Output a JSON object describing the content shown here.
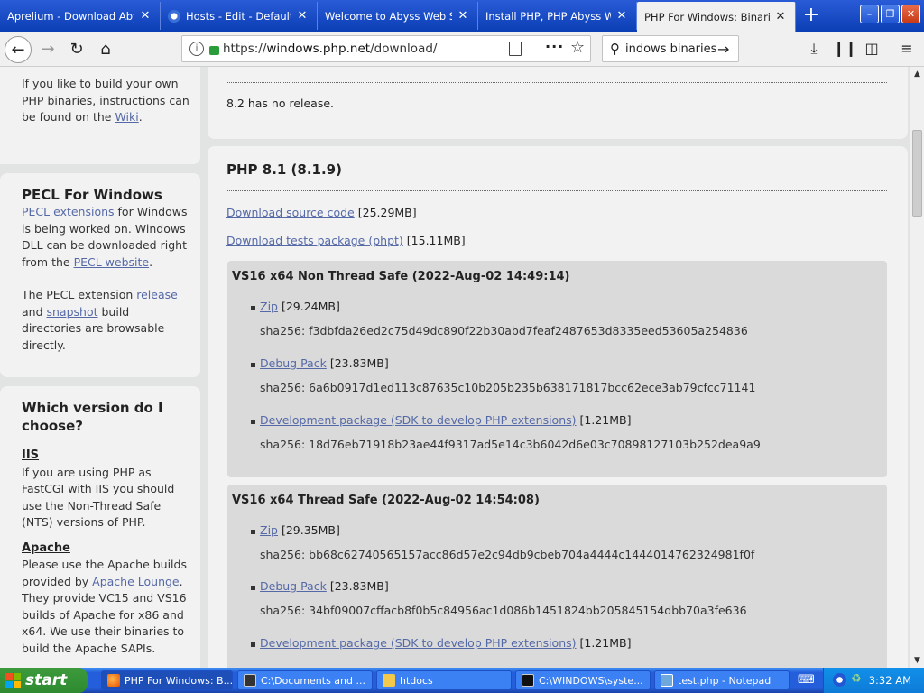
{
  "browser": {
    "tabs": [
      {
        "title": "Aprelium - Download Abyss W",
        "favicon_color": "#2257d4"
      },
      {
        "title": "Hosts - Edit - Default H",
        "favicon_color": "#3a6ed8"
      },
      {
        "title": "Welcome to Abyss Web Ser",
        "favicon_color": "#2257d4"
      },
      {
        "title": "Install PHP, PHP Abyss Web",
        "favicon_color": "#2257d4"
      },
      {
        "title": "PHP For Windows: Binaries a",
        "favicon_color": "#777bb3",
        "active": true
      }
    ],
    "url_host": "windows.php.net",
    "url_scheme": "https://",
    "url_path": "/download/",
    "search_value": "indows binaries",
    "new_tab": "+",
    "close_glyph": "✕"
  },
  "sidebar": {
    "build_own_pre": "If you like to build your own PHP binaries, instructions can be found on the ",
    "build_own_link": "Wiki",
    "build_own_post": ".",
    "pecl": {
      "title": "PECL For Windows",
      "link1": "PECL extensions",
      "text1": " for Windows is being worked on. Windows DLL can be downloaded right from the ",
      "link2": "PECL website",
      "text2": ".",
      "text3": "The PECL extension ",
      "link3": "release",
      "text4": " and ",
      "link4": "snapshot",
      "text5": " build directories are browsable directly."
    },
    "which": {
      "title": "Which version do I choose?",
      "iis_heading": "IIS",
      "iis_text": "If you are using PHP as FastCGI with IIS you should use the Non-Thread Safe (NTS) versions of PHP.",
      "apache_heading": "Apache",
      "apache_text1": "Please use the Apache builds provided by ",
      "apache_link": "Apache Lounge",
      "apache_text2": ". They provide VC15 and VS16 builds of Apache for x86 and x64. We use their binaries to build the Apache SAPIs."
    }
  },
  "main": {
    "prev_note": "8.2 has no release.",
    "release_title": "PHP 8.1 (8.1.9)",
    "source_link": "Download source code",
    "source_size": "[25.29MB]",
    "tests_link": "Download tests package (phpt)",
    "tests_size": "[15.11MB]",
    "builds": [
      {
        "title": "VS16 x64 Non Thread Safe (2022-Aug-02 14:49:14)",
        "files": [
          {
            "link": "Zip",
            "size": "[29.24MB]",
            "sha": "sha256: f3dbfda26ed2c75d49dc890f22b30abd7feaf2487653d8335eed53605a254836"
          },
          {
            "link": "Debug Pack",
            "size": "[23.83MB]",
            "sha": "sha256: 6a6b0917d1ed113c87635c10b205b235b638171817bcc62ece3ab79cfcc71141"
          },
          {
            "link": "Development package (SDK to develop PHP extensions)",
            "size": "[1.21MB]",
            "sha": "sha256: 18d76eb71918b23ae44f9317ad5e14c3b6042d6e03c70898127103b252dea9a9"
          }
        ]
      },
      {
        "title": "VS16 x64 Thread Safe (2022-Aug-02 14:54:08)",
        "files": [
          {
            "link": "Zip",
            "size": "[29.35MB]",
            "sha": "sha256: bb68c62740565157acc86d57e2c94db9cbeb704a4444c1444014762324981f0f"
          },
          {
            "link": "Debug Pack",
            "size": "[23.83MB]",
            "sha": "sha256: 34bf09007cffacb8f0b5c84956ac1d086b1451824bb205845154dbb70a3fe636"
          },
          {
            "link": "Development package (SDK to develop PHP extensions)",
            "size": "[1.21MB]",
            "sha": ""
          }
        ]
      }
    ]
  },
  "taskbar": {
    "start_label": "start",
    "tasks": [
      {
        "label": "PHP For Windows: B...",
        "icon_color": "#e87a1f",
        "active": true
      },
      {
        "label": "C:\\Documents and ...",
        "icon_color": "#333333"
      },
      {
        "label": "htdocs",
        "icon_color": "#f2c94c"
      },
      {
        "label": "C:\\WINDOWS\\syste...",
        "icon_color": "#111111"
      },
      {
        "label": "test.php - Notepad",
        "icon_color": "#6fa8dc"
      }
    ],
    "clock": "3:32 AM"
  }
}
